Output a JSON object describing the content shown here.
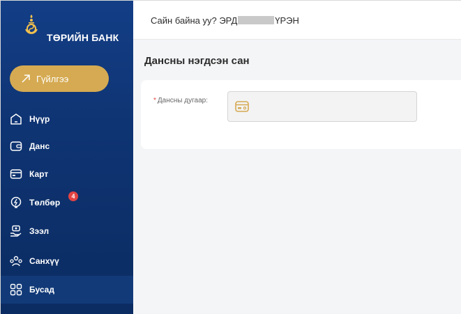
{
  "brand": {
    "name": "ТӨРИЙН БАНК"
  },
  "cta": {
    "label": "Гүйлгээ"
  },
  "nav": {
    "items": [
      {
        "label": "Нүүр",
        "icon": "home-icon"
      },
      {
        "label": "Данс",
        "icon": "wallet-icon"
      },
      {
        "label": "Карт",
        "icon": "card-icon"
      },
      {
        "label": "Төлбөр",
        "icon": "lightbulb-icon",
        "badge": "4"
      },
      {
        "label": "Зээл",
        "icon": "loan-icon"
      },
      {
        "label": "Санхүү",
        "icon": "finance-users-icon"
      },
      {
        "label": "Бусад",
        "icon": "grid-icon",
        "active": true
      }
    ]
  },
  "header": {
    "greeting_prefix": "Сайн байна уу? ЭРД",
    "greeting_suffix": "ҮРЭН"
  },
  "page": {
    "title": "Дансны нэгдсэн сан",
    "field": {
      "required_mark": "*",
      "label": "Дансны дугаар:",
      "value": ""
    }
  },
  "colors": {
    "sidebar": "#0f3473",
    "accent": "#d5aa52",
    "badge": "#e24343"
  }
}
